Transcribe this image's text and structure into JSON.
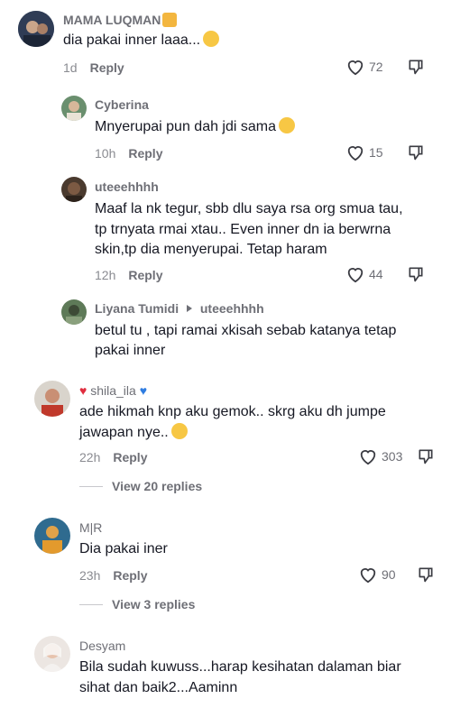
{
  "comments": [
    {
      "user": "MAMA LUQMAN",
      "text": "dia pakai inner laaa...",
      "time": "1d",
      "reply": "Reply",
      "likes": "72"
    },
    {
      "user": "Cyberina",
      "text": "Mnyerupai pun dah jdi sama",
      "time": "10h",
      "reply": "Reply",
      "likes": "15"
    },
    {
      "user": "uteeehhhh",
      "lines": [
        "Maaf la nk tegur, sbb dlu saya rsa org smua tau,",
        "tp trnyata rmai xtau.. Even inner dn ia berwrna",
        "skin,tp dia menyerupai. Tetap haram"
      ],
      "time": "12h",
      "reply": "Reply",
      "likes": "44"
    },
    {
      "user": "Liyana Tumidi",
      "reply_to": "uteeehhhh",
      "lines": [
        "betul tu , tapi ramai xkisah sebab katanya tetap",
        "pakai inner"
      ]
    },
    {
      "user": "shila_ila",
      "lines": [
        "ade hikmah knp aku gemok.. skrg aku dh jumpe",
        "jawapan nye.."
      ],
      "time": "22h",
      "reply": "Reply",
      "likes": "303",
      "view_replies": "View 20 replies"
    },
    {
      "user": "M|R",
      "text": "Dia pakai iner",
      "time": "23h",
      "reply": "Reply",
      "likes": "90",
      "view_replies": "View 3 replies"
    },
    {
      "user": "Desyam",
      "lines": [
        "Bila sudah kuwuss...harap kesihatan dalaman biar",
        "sihat dan baik2...Aaminn"
      ]
    }
  ],
  "icons": {
    "like": "heart-outline-icon",
    "dislike": "thumbs-down-icon",
    "arrow": "caret-right-icon"
  },
  "colors": {
    "username": "#6e6f76",
    "text": "#161823",
    "meta": "#8a8b91",
    "red_heart": "#e02e3f",
    "blue_heart": "#2f7de1"
  }
}
